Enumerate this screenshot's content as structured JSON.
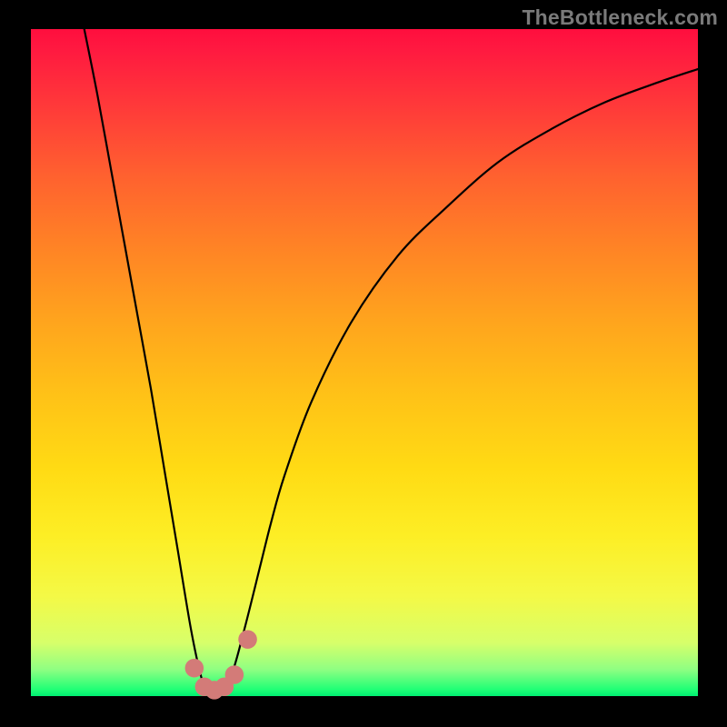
{
  "watermark": "TheBottleneck.com",
  "chart_data": {
    "type": "line",
    "title": "",
    "xlabel": "",
    "ylabel": "",
    "xlim": [
      0,
      100
    ],
    "ylim": [
      0,
      100
    ],
    "grid": false,
    "series": [
      {
        "name": "bottleneck-curve",
        "color": "#000000",
        "x": [
          8,
          10,
          12,
          14,
          16,
          18,
          20,
          22,
          24,
          25.5,
          26.5,
          28,
          30,
          32,
          34.5,
          36,
          38,
          42,
          48,
          55,
          62,
          70,
          78,
          86,
          94,
          100
        ],
        "values": [
          100,
          90,
          79,
          68,
          57,
          46,
          34,
          22,
          10,
          3,
          0.5,
          0.5,
          3,
          10,
          20,
          26,
          33,
          44,
          56,
          66,
          73,
          80,
          85,
          89,
          92,
          94
        ]
      }
    ],
    "markers": [
      {
        "name": "dot-left",
        "x": 24.5,
        "y": 4.2,
        "color": "#d37b78",
        "r": 1.4
      },
      {
        "name": "dot-bottom-1",
        "x": 26.0,
        "y": 1.4,
        "color": "#d37b78",
        "r": 1.4
      },
      {
        "name": "dot-bottom-2",
        "x": 27.5,
        "y": 0.9,
        "color": "#d37b78",
        "r": 1.4
      },
      {
        "name": "dot-bottom-3",
        "x": 29.0,
        "y": 1.4,
        "color": "#d37b78",
        "r": 1.4
      },
      {
        "name": "dot-right-low",
        "x": 30.5,
        "y": 3.2,
        "color": "#d37b78",
        "r": 1.4
      },
      {
        "name": "dot-right-high",
        "x": 32.5,
        "y": 8.5,
        "color": "#d37b78",
        "r": 1.4
      }
    ],
    "gradient_stops": [
      {
        "pos": 0,
        "color": "#ff0e3e"
      },
      {
        "pos": 12,
        "color": "#ff3b39"
      },
      {
        "pos": 33,
        "color": "#ff8425"
      },
      {
        "pos": 55,
        "color": "#ffc217"
      },
      {
        "pos": 76,
        "color": "#fdee25"
      },
      {
        "pos": 92,
        "color": "#d7ff6a"
      },
      {
        "pos": 99,
        "color": "#20ff76"
      },
      {
        "pos": 100,
        "color": "#00ef72"
      }
    ]
  }
}
